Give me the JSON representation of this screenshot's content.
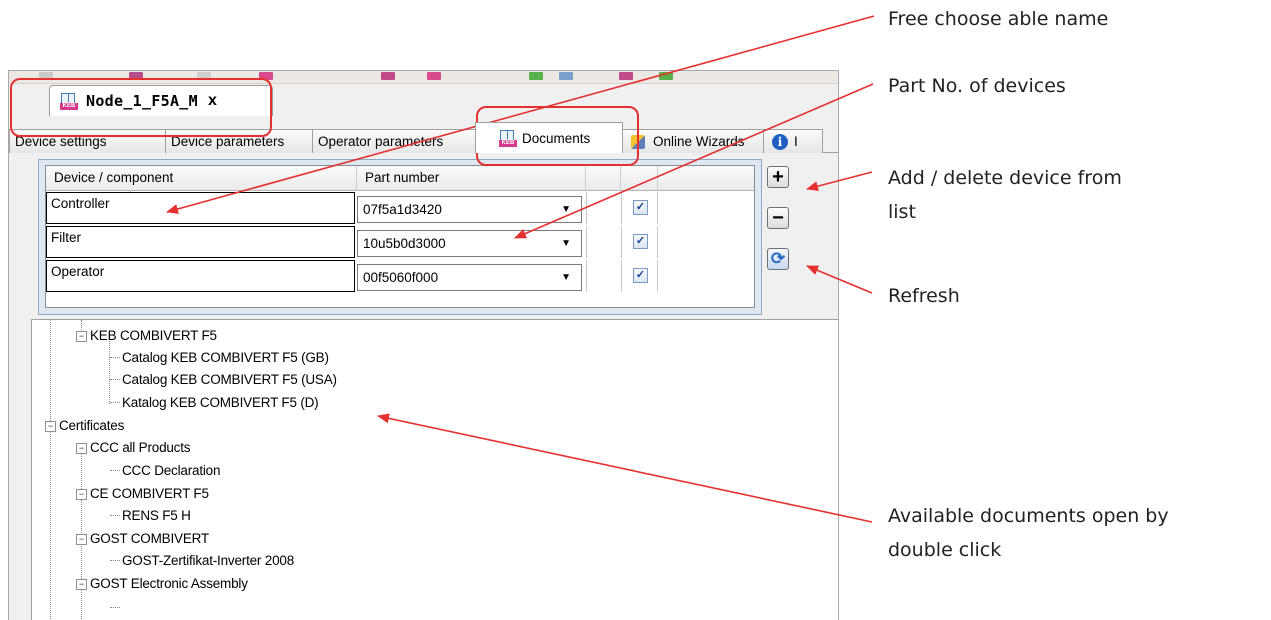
{
  "window": {
    "doc_tab_title": "Node_1_F5A_M",
    "doc_tab_close": "x"
  },
  "subtabs": [
    {
      "label": "Device settings"
    },
    {
      "label": "Device parameters"
    },
    {
      "label": "Operator parameters"
    },
    {
      "label": "Documents",
      "active": true
    },
    {
      "label": "Online Wizards"
    },
    {
      "label": "I"
    }
  ],
  "device_grid": {
    "columns": [
      "Device / component",
      "Part number"
    ],
    "rows": [
      {
        "name": "Controller",
        "part": "07f5a1d3420",
        "checked": true
      },
      {
        "name": "Filter",
        "part": "10u5b0d3000",
        "checked": true
      },
      {
        "name": "Operator",
        "part": "00f5060f000",
        "checked": true
      }
    ]
  },
  "side_buttons": {
    "add": "+",
    "delete": "−",
    "refresh": "⟳"
  },
  "tree": [
    {
      "label": "KEB COMBIVERT F5",
      "level": 1,
      "expander": "−"
    },
    {
      "label": "Catalog KEB COMBIVERT F5 (GB)",
      "level": 2
    },
    {
      "label": "Catalog KEB COMBIVERT F5 (USA)",
      "level": 2
    },
    {
      "label": "Katalog KEB COMBIVERT F5 (D)",
      "level": 2
    },
    {
      "label": "Certificates",
      "level": 0,
      "expander": "−"
    },
    {
      "label": "CCC all Products",
      "level": 1,
      "expander": "−"
    },
    {
      "label": "CCC Declaration",
      "level": 2
    },
    {
      "label": "CE COMBIVERT F5",
      "level": 1,
      "expander": "−"
    },
    {
      "label": "RENS F5 H",
      "level": 2
    },
    {
      "label": "GOST COMBIVERT",
      "level": 1,
      "expander": "−"
    },
    {
      "label": "GOST-Zertifikat-Inverter 2008",
      "level": 2
    },
    {
      "label": "GOST Electronic Assembly",
      "level": 1,
      "expander": "−"
    }
  ],
  "callouts": {
    "name": "Free choose able name",
    "part": "Part No. of devices",
    "add_delete_1": "Add / delete device from",
    "add_delete_2": "list",
    "refresh": "Refresh",
    "docs_1": "Available documents open by",
    "docs_2": "double click"
  },
  "colors": {
    "annotation": "#e53030",
    "panel": "#dde8f3",
    "keb_brand": "#d63a8c"
  }
}
